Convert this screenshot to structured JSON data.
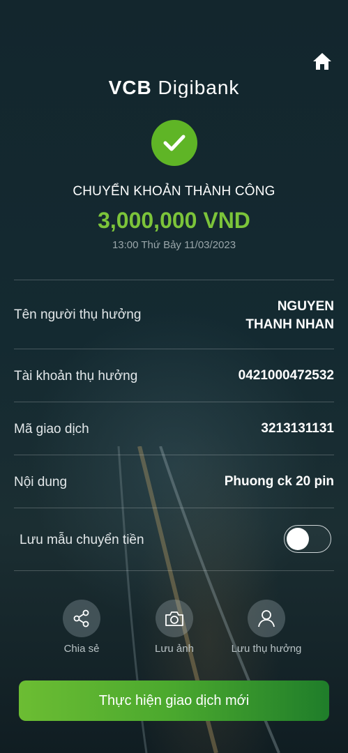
{
  "header": {
    "home_icon": "home-icon",
    "logo_bold": "VCB",
    "logo_light": "Digibank"
  },
  "status": {
    "icon": "check-icon",
    "title": "CHUYỂN KHOẢN THÀNH CÔNG",
    "amount": "3,000,000 VND",
    "datetime": "13:00 Thứ Bảy 11/03/2023",
    "accent_color": "#7cc43a"
  },
  "details": {
    "beneficiary_name": {
      "label": "Tên người thụ hưởng",
      "value_line1": "NGUYEN",
      "value_line2": "THANH NHAN"
    },
    "beneficiary_account": {
      "label": "Tài khoản thụ hưởng",
      "value": "0421000472532"
    },
    "transaction_id": {
      "label": "Mã giao dịch",
      "value": "3213131131"
    },
    "content": {
      "label": "Nội dung",
      "value": "Phuong ck 20 pin"
    }
  },
  "save_template": {
    "label": "Lưu mẫu chuyển tiền",
    "enabled": false
  },
  "actions": [
    {
      "icon": "share-icon",
      "label": "Chia sẻ"
    },
    {
      "icon": "camera-icon",
      "label": "Lưu ảnh"
    },
    {
      "icon": "person-icon",
      "label": "Lưu thụ hưởng"
    }
  ],
  "cta": {
    "label": "Thực hiện giao dịch mới"
  }
}
